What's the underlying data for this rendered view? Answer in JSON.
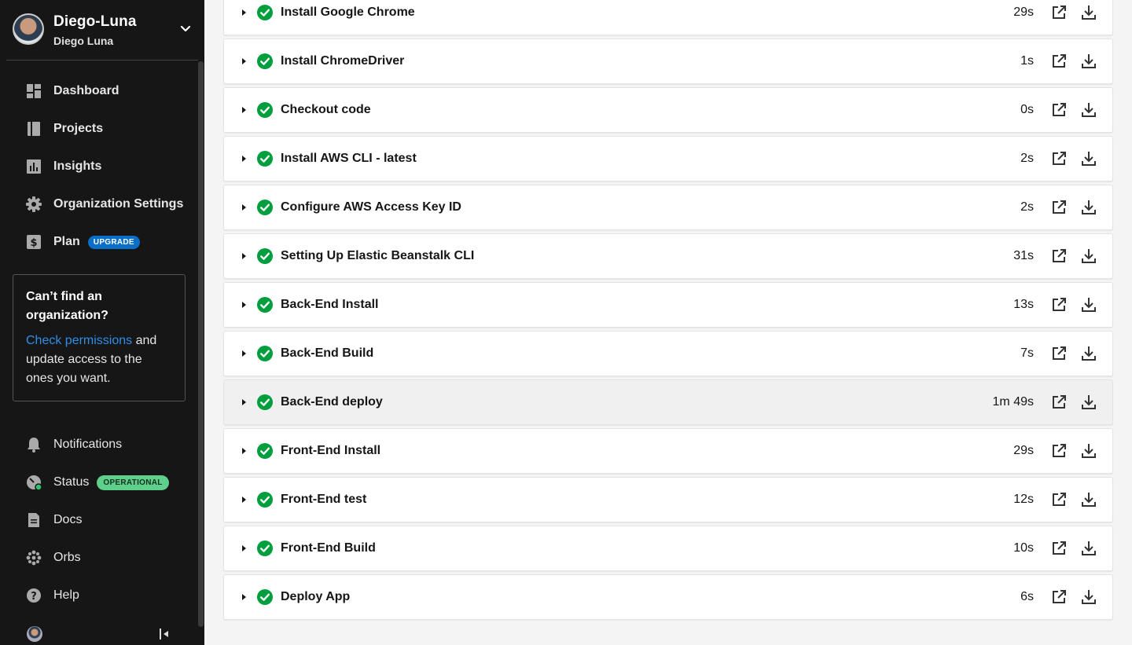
{
  "sidebar": {
    "org_name": "Diego-Luna",
    "user_name": "Diego Luna",
    "nav_main": [
      {
        "label": "Dashboard",
        "icon": "dashboard-icon"
      },
      {
        "label": "Projects",
        "icon": "projects-icon"
      },
      {
        "label": "Insights",
        "icon": "insights-icon"
      },
      {
        "label": "Organization Settings",
        "icon": "gear-icon"
      },
      {
        "label": "Plan",
        "icon": "dollar-icon",
        "badge": "UPGRADE"
      }
    ],
    "org_card": {
      "title": "Can’t find an organization?",
      "link": "Check permissions",
      "text": " and update access to the ones you want."
    },
    "nav_bottom": [
      {
        "label": "Notifications",
        "icon": "bell-icon"
      },
      {
        "label": "Status",
        "icon": "status-gauge-icon",
        "badge": "OPERATIONAL"
      },
      {
        "label": "Docs",
        "icon": "docs-icon"
      },
      {
        "label": "Orbs",
        "icon": "orbs-icon"
      },
      {
        "label": "Help",
        "icon": "help-icon"
      }
    ]
  },
  "colors": {
    "sidebar_bg": "#161616",
    "success": "#009e3d",
    "upgrade_badge": "#0b6fc9",
    "operational_badge": "#5ed08c",
    "link": "#2f8ee8"
  },
  "steps": [
    {
      "name": "Install Google Chrome",
      "duration": "29s"
    },
    {
      "name": "Install ChromeDriver",
      "duration": "1s"
    },
    {
      "name": "Checkout code",
      "duration": "0s"
    },
    {
      "name": "Install AWS CLI - latest",
      "duration": "2s"
    },
    {
      "name": "Configure AWS Access Key ID",
      "duration": "2s"
    },
    {
      "name": "Setting Up Elastic Beanstalk CLI",
      "duration": "31s"
    },
    {
      "name": "Back-End Install",
      "duration": "13s"
    },
    {
      "name": "Back-End Build",
      "duration": "7s"
    },
    {
      "name": "Back-End deploy",
      "duration": "1m 49s"
    },
    {
      "name": "Front-End Install",
      "duration": "29s"
    },
    {
      "name": "Front-End test",
      "duration": "12s"
    },
    {
      "name": "Front-End Build",
      "duration": "10s"
    },
    {
      "name": "Deploy App",
      "duration": "6s"
    }
  ]
}
